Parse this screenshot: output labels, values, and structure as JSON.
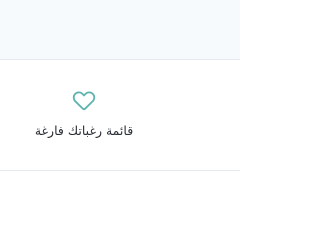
{
  "wishlist": {
    "empty_message": "قائمة رغباتك فارغة",
    "icon": "heart-outline-icon",
    "accent_color": "#5fb3ad"
  }
}
